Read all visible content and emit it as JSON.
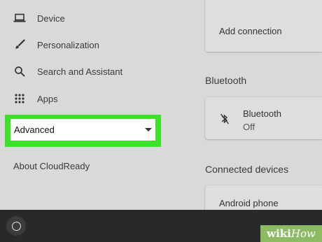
{
  "sidebar": {
    "items": [
      {
        "label": "Device",
        "icon": "laptop-icon"
      },
      {
        "label": "Personalization",
        "icon": "brush-icon"
      },
      {
        "label": "Search and Assistant",
        "icon": "search-icon"
      },
      {
        "label": "Apps",
        "icon": "apps-grid-icon"
      }
    ],
    "advanced_label": "Advanced",
    "about_label": "About CloudReady"
  },
  "main": {
    "add_connection_label": "Add connection",
    "bluetooth_section_title": "Bluetooth",
    "bluetooth_card": {
      "title": "Bluetooth",
      "status": "Off",
      "icon": "bluetooth-off-icon"
    },
    "connected_devices_title": "Connected devices",
    "android_phone_label": "Android phone"
  },
  "colors": {
    "highlight": "#3ee02a",
    "taskbar": "#28292b",
    "background": "#d9d9d9"
  },
  "watermark": {
    "wiki": "wiki",
    "how": "How"
  }
}
